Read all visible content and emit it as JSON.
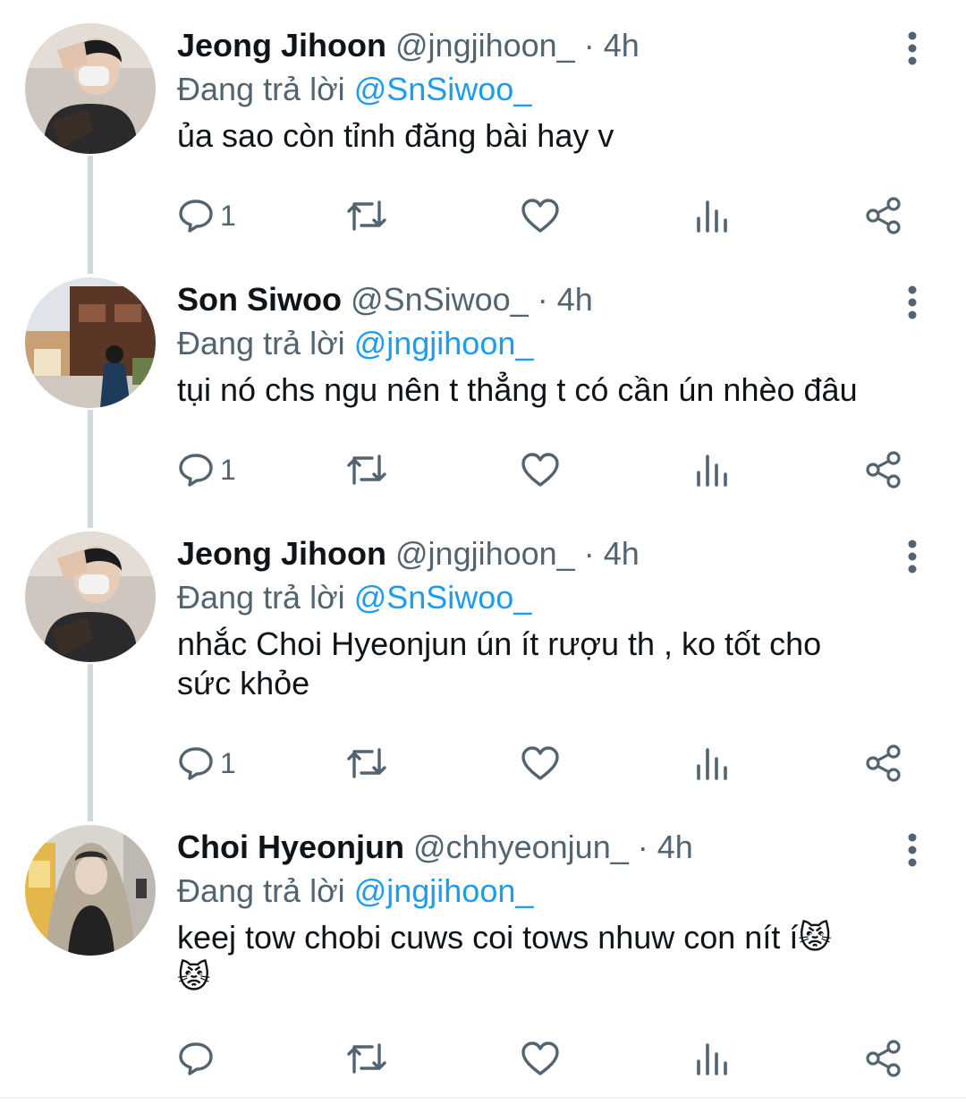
{
  "tweets": [
    {
      "name": "Jeong Jihoon",
      "handle": "@jngjihoon_",
      "separator": "·",
      "time": "4h",
      "reply_prefix": "Đang trả lời",
      "reply_to": "@SnSiwoo_",
      "text": "ủa sao còn tỉnh đăng bài hay v",
      "reply_count": "1",
      "avatar_icon": "profile-photo-masked-man"
    },
    {
      "name": "Son Siwoo",
      "handle": "@SnSiwoo_",
      "separator": "·",
      "time": "4h",
      "reply_prefix": "Đang trả lời",
      "reply_to": "@jngjihoon_",
      "text": "tụi nó chs ngu nên t thẳng t có cần ún nhèo đâu",
      "reply_count": "1",
      "avatar_icon": "profile-photo-street"
    },
    {
      "name": "Jeong Jihoon",
      "handle": "@jngjihoon_",
      "separator": "·",
      "time": "4h",
      "reply_prefix": "Đang trả lời",
      "reply_to": "@SnSiwoo_",
      "text_line1": "nhắc Choi Hyeonjun ún ít rượu th , ko tốt cho",
      "text_line2": "sức khỏe",
      "reply_count": "1",
      "avatar_icon": "profile-photo-masked-man"
    },
    {
      "name": "Choi Hyeonjun",
      "handle": "@chhyeonjun_",
      "separator": "·",
      "time": "4h",
      "reply_prefix": "Đang trả lời",
      "reply_to": "@jngjihoon_",
      "text_line1": "keej tow chobi cuws coi tows nhuw con nít í",
      "emoji1": "😾",
      "emoji2": "😾",
      "reply_count": "",
      "avatar_icon": "profile-photo-hooded"
    }
  ],
  "colors": {
    "mention": "#1d9bf0",
    "secondary": "#536471",
    "thread_line": "#cfd9de"
  }
}
